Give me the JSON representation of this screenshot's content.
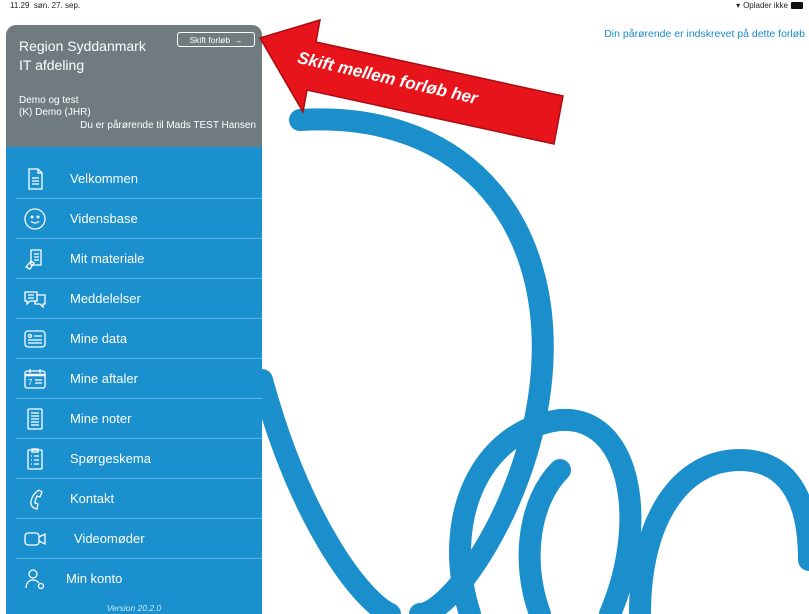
{
  "status_bar": {
    "time": "11.29",
    "date": "søn. 27. sep.",
    "charging": "Oplader ikke"
  },
  "top_notice": "Din pårørende er indskrevet på dette forløb",
  "header": {
    "region": "Region Syddanmark",
    "department": "IT afdeling",
    "switch_label": "Skift forløb",
    "demo_line1": "Demo og test",
    "demo_line2": "(K) Demo (JHR)",
    "relative_line": "Du er pårørende til Mads TEST Hansen"
  },
  "menu": [
    {
      "label": "Velkommen",
      "icon": "document-icon"
    },
    {
      "label": "Vidensbase",
      "icon": "smiley-icon"
    },
    {
      "label": "Mit materiale",
      "icon": "material-icon"
    },
    {
      "label": "Meddelelser",
      "icon": "chat-bubbles-icon"
    },
    {
      "label": "Mine data",
      "icon": "id-card-icon"
    },
    {
      "label": "Mine aftaler",
      "icon": "calendar-icon"
    },
    {
      "label": "Mine noter",
      "icon": "notes-icon"
    },
    {
      "label": "Spørgeskema",
      "icon": "clipboard-icon"
    },
    {
      "label": "Kontakt",
      "icon": "phone-icon"
    },
    {
      "label": "Videomøder",
      "icon": "video-camera-icon"
    },
    {
      "label": "Min konto",
      "icon": "user-icon"
    }
  ],
  "version": "Version 20.2.0",
  "annotation": "Skift mellem forløb her",
  "colors": {
    "menu_blue": "#1a90cf",
    "header_gray": "#707b80",
    "arrow_red": "#e8141b"
  }
}
